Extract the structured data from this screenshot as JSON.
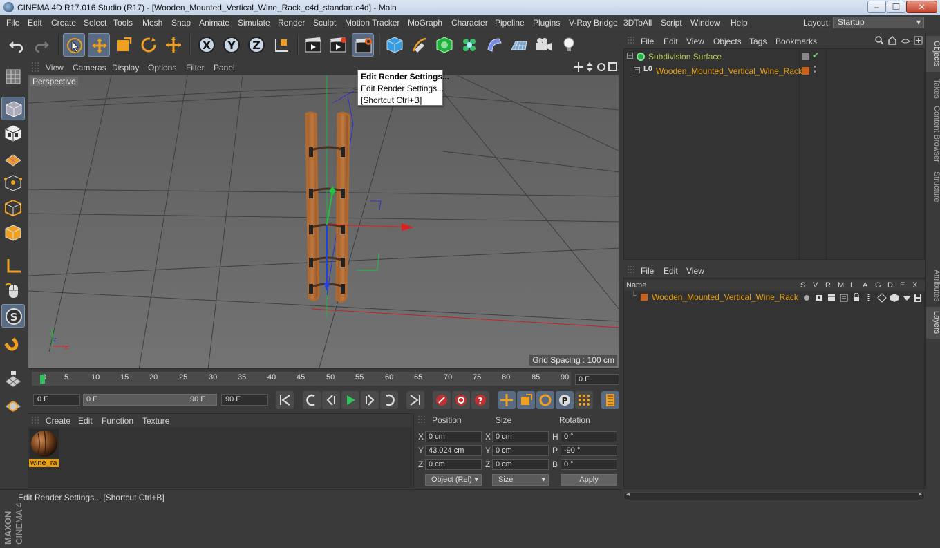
{
  "window": {
    "title": "CINEMA 4D R17.016 Studio (R17) - [Wooden_Mounted_Vertical_Wine_Rack_c4d_standart.c4d] - Main",
    "minimize": "–",
    "restore": "❐",
    "close": "✕"
  },
  "menubar": {
    "items": [
      "File",
      "Edit",
      "Create",
      "Select",
      "Tools",
      "Mesh",
      "Snap",
      "Animate",
      "Simulate",
      "Render",
      "Sculpt",
      "Motion Tracker",
      "MoGraph",
      "Character",
      "Pipeline",
      "Plugins",
      "V-Ray Bridge",
      "3DToAll",
      "Script",
      "Window",
      "Help"
    ],
    "layout_label": "Layout:",
    "layout_value": "Startup"
  },
  "viewport": {
    "menu": [
      "View",
      "Cameras",
      "Display",
      "Options",
      "Filter",
      "Panel"
    ],
    "label": "Perspective",
    "grid_spacing": "Grid Spacing : 100 cm"
  },
  "tooltip": {
    "title": "Edit Render Settings...",
    "description": "Edit Render Settings...",
    "shortcut": "[Shortcut Ctrl+B]"
  },
  "timeline": {
    "ticks": [
      "0",
      "5",
      "10",
      "15",
      "20",
      "25",
      "30",
      "35",
      "40",
      "45",
      "50",
      "55",
      "60",
      "65",
      "70",
      "75",
      "80",
      "85",
      "90"
    ],
    "current_frame": "0 F"
  },
  "transport": {
    "start_frame": "0 F",
    "range_start": "0 F",
    "range_end": "90 F",
    "end_frame": "90 F"
  },
  "material_manager": {
    "menu": [
      "Create",
      "Edit",
      "Function",
      "Texture"
    ],
    "material_name": "wine_ra"
  },
  "coordinates": {
    "headers": {
      "position": "Position",
      "size": "Size",
      "rotation": "Rotation"
    },
    "rows": [
      {
        "axis": "X",
        "position": "0 cm",
        "size_axis": "X",
        "size": "0 cm",
        "rot_axis": "H",
        "rotation": "0 °"
      },
      {
        "axis": "Y",
        "position": "43.024 cm",
        "size_axis": "Y",
        "size": "0 cm",
        "rot_axis": "P",
        "rotation": "-90 °"
      },
      {
        "axis": "Z",
        "position": "0 cm",
        "size_axis": "Z",
        "size": "0 cm",
        "rot_axis": "B",
        "rotation": "0 °"
      }
    ],
    "mode": "Object (Rel)",
    "size_mode": "Size",
    "apply": "Apply"
  },
  "object_manager": {
    "menu": [
      "File",
      "Edit",
      "View",
      "Objects",
      "Tags",
      "Bookmarks"
    ],
    "objects": [
      {
        "name": "Subdivision Surface",
        "color": "#b5c95a"
      },
      {
        "name": "Wooden_Mounted_Vertical_Wine_Rack",
        "color": "#e8a010"
      }
    ]
  },
  "layer_manager": {
    "menu": [
      "File",
      "Edit",
      "View"
    ],
    "columns": [
      "Name",
      "S",
      "V",
      "R",
      "M",
      "L",
      "A",
      "G",
      "D",
      "E",
      "X"
    ],
    "layers": [
      {
        "name": "Wooden_Mounted_Vertical_Wine_Rack",
        "color": "#c8601e"
      }
    ]
  },
  "right_tabs": [
    "Objects",
    "Takes",
    "Content Browser",
    "Structure",
    "Attributes",
    "Layers"
  ],
  "status": {
    "text": "Edit Render Settings... [Shortcut Ctrl+B]"
  },
  "branding": {
    "logo": "MAXON CINEMA 4D"
  },
  "colors": {
    "accent_orange": "#e8a010",
    "axis_x": "#e02020",
    "axis_y": "#20c040",
    "axis_z": "#2040e0",
    "selection_blue": "#596b82"
  }
}
